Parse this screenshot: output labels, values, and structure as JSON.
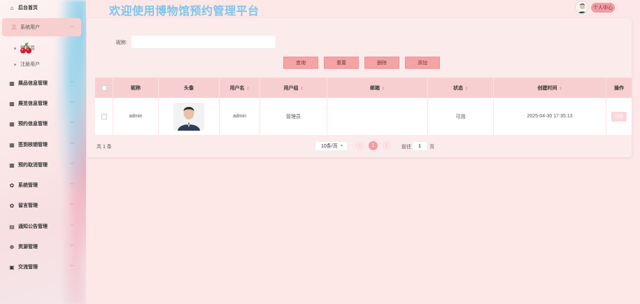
{
  "header": {
    "title": "欢迎使用博物馆预约管理平台",
    "profile_label": "个人中心"
  },
  "sidebar": {
    "items": [
      {
        "label": "后台首页",
        "icon": "home-icon"
      },
      {
        "label": "系统用户",
        "icon": "user-icon"
      },
      {
        "label": "展品信息管理",
        "icon": "grid-icon"
      },
      {
        "label": "展览信息管理",
        "icon": "grid-icon"
      },
      {
        "label": "预约信息管理",
        "icon": "grid-icon"
      },
      {
        "label": "签到核销管理",
        "icon": "grid-icon"
      },
      {
        "label": "预约取消管理",
        "icon": "grid-icon"
      },
      {
        "label": "系统管理",
        "icon": "gear-icon"
      },
      {
        "label": "留言管理",
        "icon": "gear-icon"
      },
      {
        "label": "通知公告管理",
        "icon": "notice-icon"
      },
      {
        "label": "资源管理",
        "icon": "plus-circle-icon"
      },
      {
        "label": "交流管理",
        "icon": "chat-icon"
      }
    ],
    "subitems": [
      {
        "label": "管理员"
      },
      {
        "label": "注册用户"
      }
    ]
  },
  "search": {
    "label": "昵称:",
    "value": "",
    "placeholder": ""
  },
  "toolbar": {
    "query": "查询",
    "reset": "重置",
    "delete": "删除",
    "add": "添加"
  },
  "table": {
    "columns": [
      "昵称",
      "头像",
      "用户名",
      "用户组",
      "邮箱",
      "状态",
      "创建时间",
      "操作"
    ],
    "rows": [
      {
        "nickname": "admin",
        "username": "admin",
        "group": "管理员",
        "email": "",
        "status": "可用",
        "created": "2025-04-30 17:35:13",
        "action": "详情"
      }
    ]
  },
  "pagination": {
    "total": "共 1 条",
    "page_size": "10条/页",
    "current": "1",
    "goto_label": "前往",
    "goto_value": "1",
    "goto_unit": "页"
  },
  "colors": {
    "accent": "#f6a3a6",
    "title": "#7cc6ea",
    "background": "#fde7e7",
    "header_row": "#f8cfd1"
  }
}
